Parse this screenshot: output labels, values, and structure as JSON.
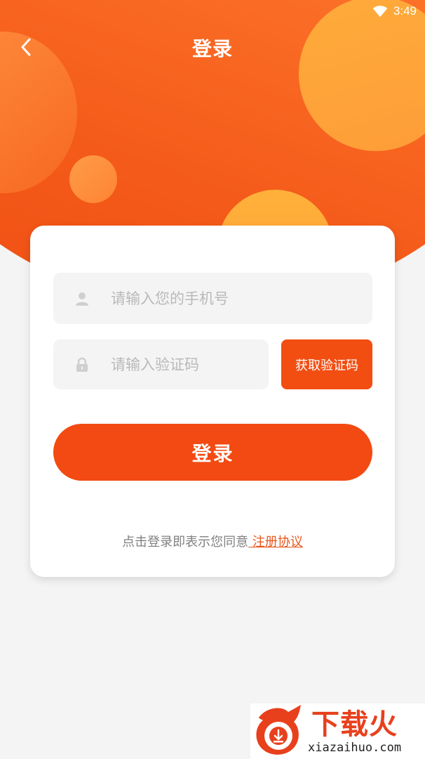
{
  "status_bar": {
    "time": "3:49",
    "wifi_icon": "wifi-icon"
  },
  "header": {
    "title": "登录",
    "back_icon": "chevron-left-icon",
    "gradient_colors": [
      "#ff9a3c",
      "#f45a1a"
    ]
  },
  "form": {
    "phone": {
      "placeholder": "请输入您的手机号",
      "value": "",
      "icon": "user-icon"
    },
    "code": {
      "placeholder": "请输入验证码",
      "value": "",
      "icon": "lock-icon"
    },
    "get_code_label": "获取验证码",
    "login_label": "登录",
    "accent_color": "#f24e12"
  },
  "agreement": {
    "text": "点击登录即表示您同意",
    "link_text": " 注册协议"
  },
  "watermark": {
    "brand": "下载火",
    "domain": "xiazaihuo.com"
  }
}
